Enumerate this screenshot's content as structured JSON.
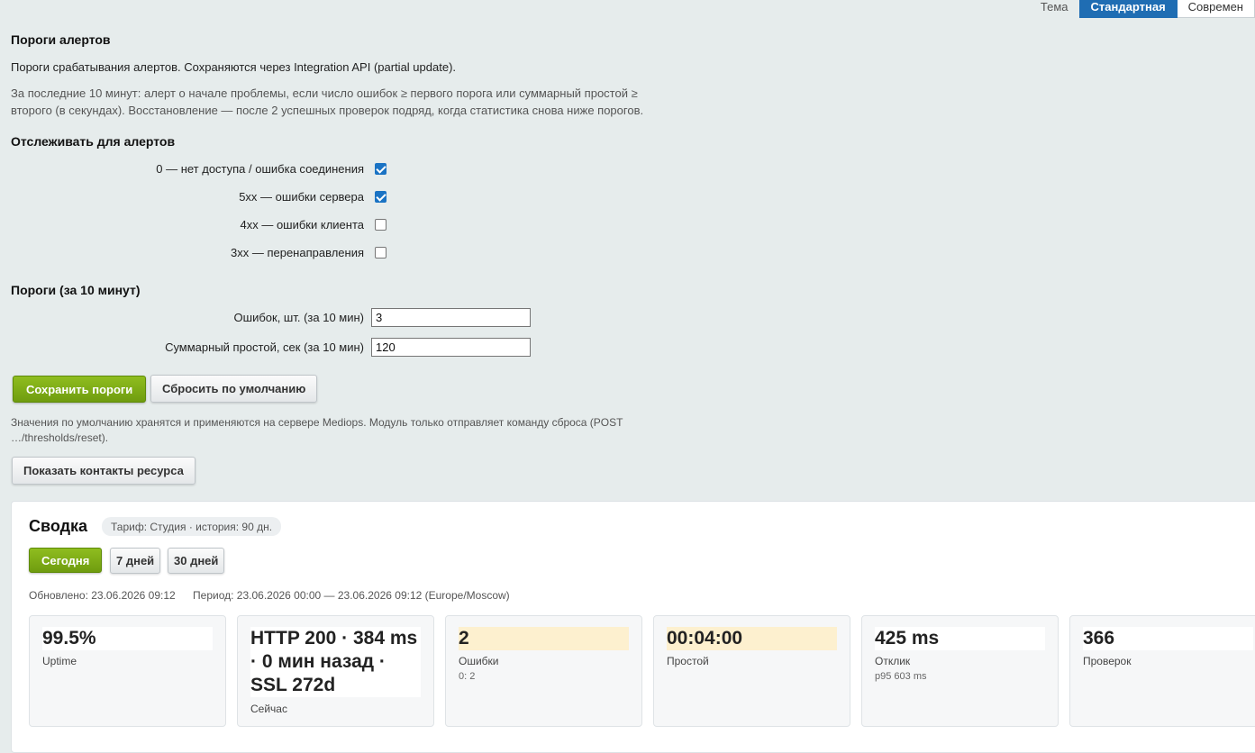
{
  "theme": {
    "label": "Тема",
    "options": [
      "Стандартная",
      "Современ"
    ]
  },
  "thresholds": {
    "title": "Пороги алертов",
    "description": "Пороги срабатывания алертов. Сохраняются через Integration API (partial update).",
    "note_line1": "За последние 10 минут: алерт о начале проблемы, если число ошибок ≥ первого порога или суммарный простой ≥",
    "note_line2": "второго (в секундах). Восстановление — после 2 успешных проверок подряд, когда статистика снова ниже порогов.",
    "track_title": "Отслеживать для алертов",
    "track": [
      {
        "label": "0 — нет доступа / ошибка соединения",
        "checked": true
      },
      {
        "label": "5xx — ошибки сервера",
        "checked": true
      },
      {
        "label": "4xx — ошибки клиента",
        "checked": false
      },
      {
        "label": "3xx — перенаправления",
        "checked": false
      }
    ],
    "limits_title": "Пороги (за 10 минут)",
    "errors_label": "Ошибок, шт. (за 10 мин)",
    "errors_value": "3",
    "downtime_label": "Суммарный простой, сек (за 10 мин)",
    "downtime_value": "120",
    "save_label": "Сохранить пороги",
    "reset_label": "Сбросить по умолчанию",
    "defaults_note_line1": "Значения по умолчанию хранятся и применяются на сервере Mediops. Модуль только отправляет команду сброса (POST",
    "defaults_note_line2": "…/thresholds/reset).",
    "contacts_label": "Показать контакты ресурса"
  },
  "summary": {
    "title": "Сводка",
    "badge": "Тариф: Студия · история: 90 дн.",
    "periods": [
      "Сегодня",
      "7 дней",
      "30 дней"
    ],
    "updated": "Обновлено: 23.06.2026 09:12",
    "period": "Период: 23.06.2026 00:00 — 23.06.2026 09:12 (Europe/Moscow)",
    "cards": [
      {
        "value": "99.5%",
        "label": "Uptime",
        "sub": ""
      },
      {
        "value": "HTTP 200 · 384 ms · 0 мин назад · SSL 272d",
        "label": "Сейчас",
        "sub": ""
      },
      {
        "value": "2",
        "label": "Ошибки",
        "sub": "0: 2"
      },
      {
        "value": "00:04:00",
        "label": "Простой",
        "sub": ""
      },
      {
        "value": "425 ms",
        "label": "Отклик",
        "sub": "p95 603 ms"
      },
      {
        "value": "366",
        "label": "Проверок",
        "sub": ""
      }
    ]
  },
  "colors": {
    "accent_blue": "#1f6db3",
    "accent_green": "#7cab14",
    "warn_bg": "#fdf0cf"
  }
}
